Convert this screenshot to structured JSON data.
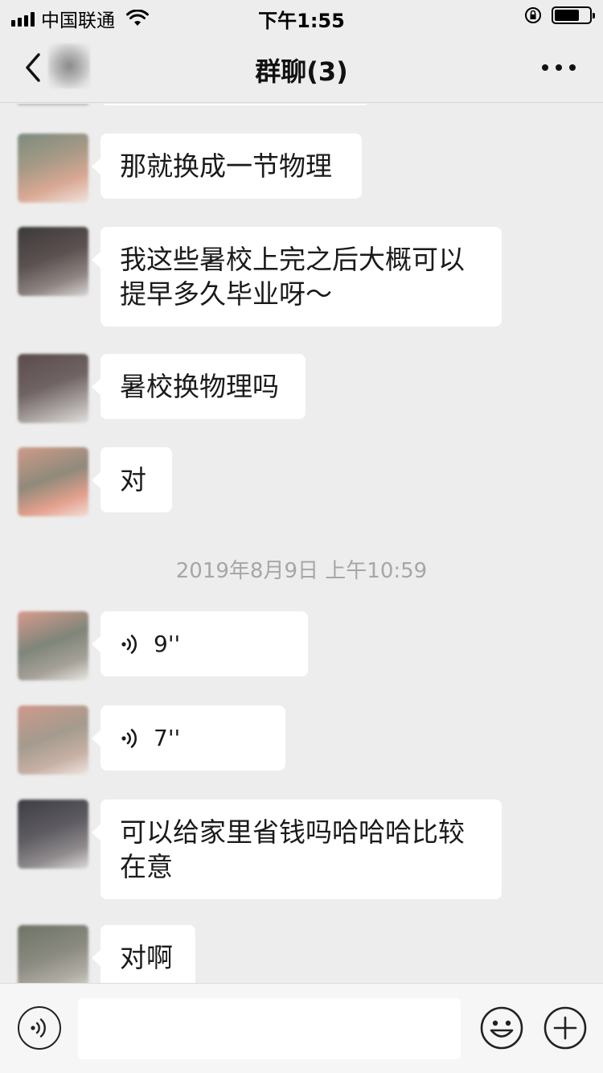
{
  "status_bar": {
    "carrier": "中国联通",
    "time": "下午1:55"
  },
  "nav": {
    "title": "群聊(3)"
  },
  "messages": [
    {
      "type": "text",
      "lines": [
        "那就换成一节物理"
      ]
    },
    {
      "type": "text",
      "lines": [
        "我这些暑校上完之后大概可以",
        "提早多久毕业呀～"
      ]
    },
    {
      "type": "text",
      "lines": [
        "暑校换物理吗"
      ]
    },
    {
      "type": "text",
      "lines": [
        "对"
      ]
    },
    {
      "type": "voice",
      "duration": "9''"
    },
    {
      "type": "voice",
      "duration": "7''"
    },
    {
      "type": "text",
      "lines": [
        "可以给家里省钱吗哈哈哈比较",
        "在意"
      ]
    },
    {
      "type": "text",
      "lines": [
        "对啊"
      ]
    }
  ],
  "timestamp": "2019年8月9日 上午10:59",
  "input": {
    "placeholder": ""
  },
  "icons": {
    "back": "back-chevron-icon",
    "more": "more-dots-icon",
    "voice_toggle": "voice-icon",
    "emoji": "emoji-icon",
    "plus": "plus-icon"
  }
}
